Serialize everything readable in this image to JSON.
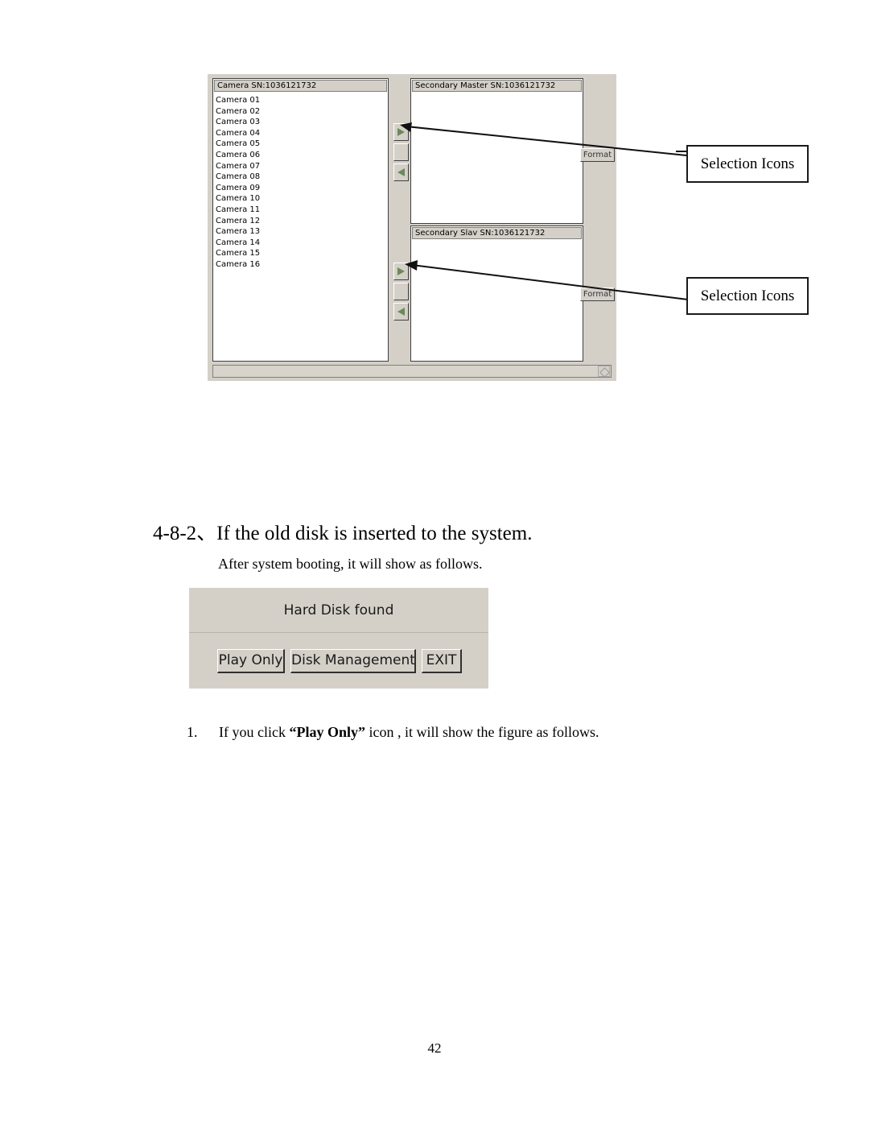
{
  "page": {
    "number": "42"
  },
  "figure_disk_dialog": {
    "left_panel": {
      "header": "Camera SN:1036121732",
      "cameras": [
        "Camera 01",
        "Camera 02",
        "Camera 03",
        "Camera 04",
        "Camera 05",
        "Camera 06",
        "Camera 07",
        "Camera 08",
        "Camera 09",
        "Camera 10",
        "Camera 11",
        "Camera 12",
        "Camera 13",
        "Camera 14",
        "Camera 15",
        "Camera 16"
      ]
    },
    "right_panels": {
      "master_header": "Secondary Master SN:1036121732",
      "slave_header": "Secondary Slav SN:1036121732"
    },
    "format_buttons": {
      "master": "Format",
      "slave": "Format"
    },
    "selection_icons": {
      "add_glyph": "right-triangle",
      "blank_glyph": "",
      "remove_glyph": "left-triangle"
    },
    "statusbar": {
      "text": "",
      "grip": "resize-grip"
    }
  },
  "callouts": [
    {
      "label": "Selection Icons"
    },
    {
      "label": "Selection Icons"
    }
  ],
  "content": {
    "heading": "4-8-2、If the old disk is inserted to the system.",
    "subtext": "After system booting, it will show as follows.",
    "list_item": {
      "number": "1.",
      "text_before": "If you click ",
      "bold": "“Play Only”",
      "text_after": " icon , it will show the figure as follows."
    }
  },
  "figure_hard_disk_found": {
    "title": "Hard Disk found",
    "buttons": [
      {
        "label": "Play Only"
      },
      {
        "label": "Disk Management"
      },
      {
        "label": "EXIT"
      }
    ]
  }
}
